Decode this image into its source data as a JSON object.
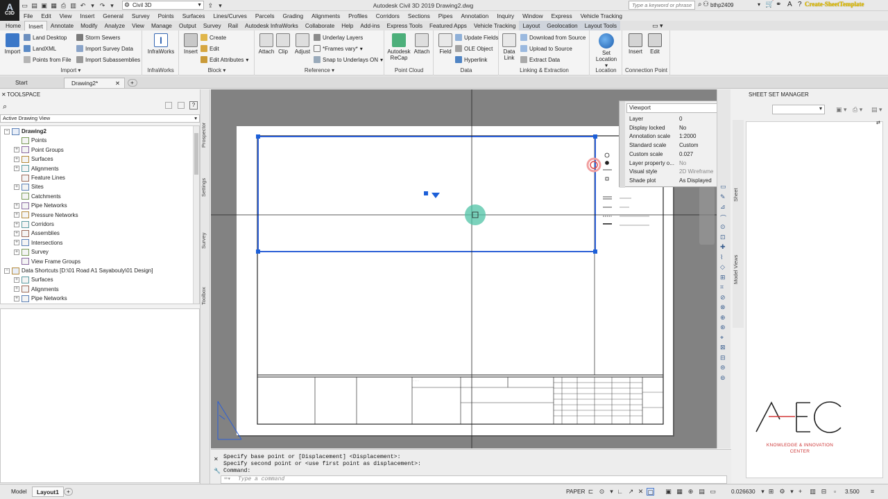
{
  "title_bar": {
    "app_badge": "C3D",
    "workspace": "Civil 3D",
    "window_title": "Autodesk Civil 3D 2019   Drawing2.dwg",
    "search_placeholder": "Type a keyword or phrase",
    "user": "bthp2409",
    "overlay_caption": "Create-SheetTemplate"
  },
  "menu": [
    "File",
    "Edit",
    "View",
    "Insert",
    "General",
    "Survey",
    "Points",
    "Surfaces",
    "Lines/Curves",
    "Parcels",
    "Grading",
    "Alignments",
    "Profiles",
    "Corridors",
    "Sections",
    "Pipes",
    "Annotation",
    "Inquiry",
    "Window",
    "Express",
    "Vehicle Tracking"
  ],
  "ribbon_tabs": [
    {
      "label": "Home"
    },
    {
      "label": "Insert",
      "active": true
    },
    {
      "label": "Annotate"
    },
    {
      "label": "Modify"
    },
    {
      "label": "Analyze"
    },
    {
      "label": "View"
    },
    {
      "label": "Manage"
    },
    {
      "label": "Output"
    },
    {
      "label": "Survey"
    },
    {
      "label": "Rail"
    },
    {
      "label": "Autodesk InfraWorks"
    },
    {
      "label": "Collaborate"
    },
    {
      "label": "Help"
    },
    {
      "label": "Add-ins"
    },
    {
      "label": "Express Tools"
    },
    {
      "label": "Featured Apps"
    },
    {
      "label": "Vehicle Tracking"
    },
    {
      "label": "Layout",
      "ctx": true
    },
    {
      "label": "Geolocation",
      "ctx": true
    },
    {
      "label": "Layout Tools",
      "ctx": true
    }
  ],
  "ribbon": {
    "import": {
      "title": "Import",
      "big": "Import",
      "items": [
        "Land Desktop",
        "Storm Sewers",
        "LandXML",
        "Import Survey Data",
        "Points from File",
        "Import Subassemblies"
      ]
    },
    "infraworks": {
      "title": "InfraWorks",
      "big": "InfraWorks"
    },
    "block": {
      "title": "Block",
      "big": "Insert",
      "items": [
        "Create",
        "Edit",
        "Edit Attributes"
      ]
    },
    "reference": {
      "title": "Reference",
      "bigs": [
        "Attach",
        "Clip",
        "Adjust"
      ],
      "items": [
        "Underlay Layers",
        "*Frames vary*",
        "Snap to Underlays ON"
      ]
    },
    "point_cloud": {
      "title": "Point Cloud",
      "bigs": [
        "Autodesk ReCap",
        "Attach"
      ]
    },
    "data": {
      "title": "Data",
      "big": "Field",
      "items": [
        "Update Fields",
        "OLE Object",
        "Hyperlink"
      ]
    },
    "linking": {
      "title": "Linking & Extraction",
      "big": "Data Link",
      "items": [
        "Download from Source",
        "Upload to Source",
        "Extract  Data"
      ]
    },
    "location": {
      "title": "Location",
      "big": "Set Location"
    },
    "connection": {
      "title": "Connection Point",
      "bigs": [
        "Insert",
        "Edit"
      ]
    }
  },
  "doc_tabs": [
    {
      "label": "Start"
    },
    {
      "label": "Drawing2*",
      "active": true
    }
  ],
  "toolspace": {
    "title": "TOOLSPACE",
    "view": "Active Drawing View",
    "tree": [
      {
        "label": "Drawing2",
        "level": 0,
        "toggle": "−",
        "bold": true
      },
      {
        "label": "Points",
        "level": 1,
        "toggle": ""
      },
      {
        "label": "Point Groups",
        "level": 1,
        "toggle": "+"
      },
      {
        "label": "Surfaces",
        "level": 1,
        "toggle": "+"
      },
      {
        "label": "Alignments",
        "level": 1,
        "toggle": "+"
      },
      {
        "label": "Feature Lines",
        "level": 1,
        "toggle": ""
      },
      {
        "label": "Sites",
        "level": 1,
        "toggle": "+"
      },
      {
        "label": "Catchments",
        "level": 1,
        "toggle": ""
      },
      {
        "label": "Pipe Networks",
        "level": 1,
        "toggle": "+"
      },
      {
        "label": "Pressure Networks",
        "level": 1,
        "toggle": "+"
      },
      {
        "label": "Corridors",
        "level": 1,
        "toggle": "+"
      },
      {
        "label": "Assemblies",
        "level": 1,
        "toggle": "+"
      },
      {
        "label": "Intersections",
        "level": 1,
        "toggle": "+"
      },
      {
        "label": "Survey",
        "level": 1,
        "toggle": "+"
      },
      {
        "label": "View Frame Groups",
        "level": 1,
        "toggle": ""
      },
      {
        "label": "Data Shortcuts [D:\\01 Road A1 Sayabouly\\01 Design]",
        "level": 0,
        "toggle": "−"
      },
      {
        "label": "Surfaces",
        "level": 1,
        "toggle": "+"
      },
      {
        "label": "Alignments",
        "level": 1,
        "toggle": "+"
      },
      {
        "label": "Pipe Networks",
        "level": 1,
        "toggle": "+"
      },
      {
        "label": "Pressure Networks",
        "level": 1,
        "toggle": "+"
      }
    ],
    "side_tabs": [
      "Prospector",
      "Settings",
      "Survey",
      "Toolbox"
    ]
  },
  "properties": {
    "object_type": "Viewport",
    "rows": [
      {
        "key": "Layer",
        "value": "0"
      },
      {
        "key": "Display locked",
        "value": "No"
      },
      {
        "key": "Annotation scale",
        "value": "1:2000"
      },
      {
        "key": "Standard scale",
        "value": "Custom"
      },
      {
        "key": "Custom scale",
        "value": "0.027"
      },
      {
        "key": "Layer property o...",
        "value": "No",
        "grey": true
      },
      {
        "key": "Visual style",
        "value": "2D Wireframe",
        "grey": true
      },
      {
        "key": "Shade plot",
        "value": "As Displayed"
      }
    ]
  },
  "sheet_set": {
    "title": "SHEET SET MANAGER",
    "side_tabs": [
      "Sheet",
      "Model Views"
    ]
  },
  "command_line": {
    "history": [
      "Specify base point or [Displacement] <Displacement>:",
      "Specify second point or <use first point as displacement>:",
      "Command:"
    ],
    "placeholder": "Type a command"
  },
  "status_bar": {
    "layout_tabs": [
      {
        "label": "Model"
      },
      {
        "label": "Layout1",
        "active": true
      }
    ],
    "space": "PAPER",
    "scale": "0.026630",
    "elevation": "3.500"
  },
  "aec_logo": {
    "mark": "AEC",
    "line1": "KNOWLEDGE & INNOVATION",
    "line2": "CENTER",
    "accent": "#d43a3a"
  },
  "colors": {
    "selection": "#2c5fd6",
    "grip": "#1c5fd8",
    "cursor_halo": "#4fc3a6",
    "paper_bg": "#828282"
  }
}
